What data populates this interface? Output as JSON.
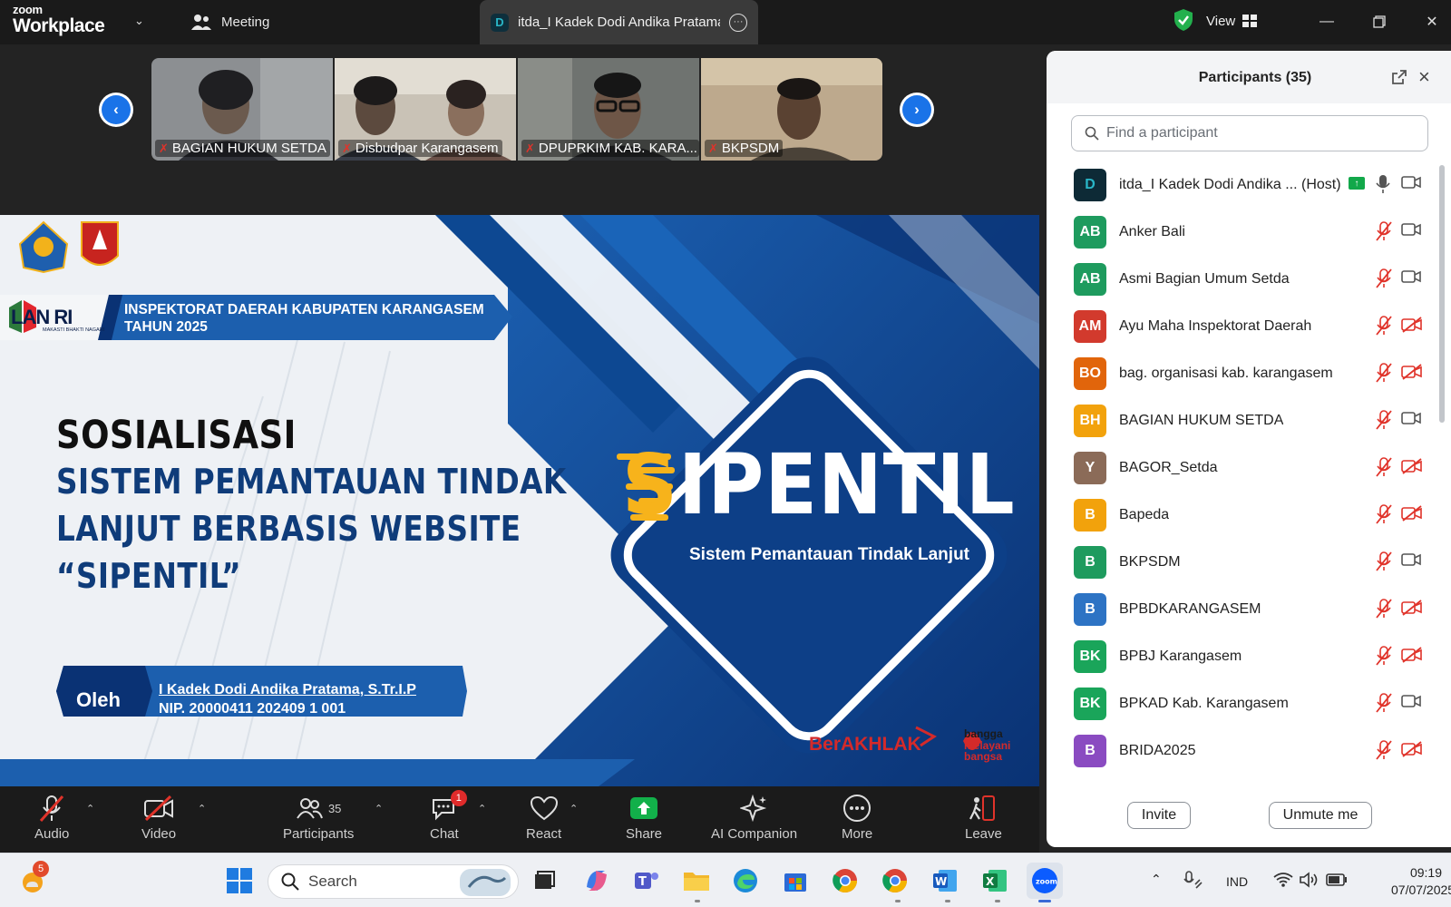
{
  "topbar": {
    "logo_line1": "zoom",
    "logo_line2": "Workplace",
    "meeting_tab": "Meeting",
    "active_tab_title": "itda_I Kadek Dodi Andika Pratama",
    "active_tab_badge": "D",
    "view_label": "View"
  },
  "thumbnails": [
    {
      "name": "BAGIAN HUKUM SETDA"
    },
    {
      "name": "Disbudpar Karangasem"
    },
    {
      "name": "DPUPRKIM KAB. KARA..."
    },
    {
      "name": "BKPSDM"
    }
  ],
  "slide": {
    "banner_line1": "INSPEKTORAT DAERAH KABUPATEN KARANGASEM",
    "banner_line2": "TAHUN 2025",
    "lanri": "LAN RI",
    "lanri_sub": "MAKASTI BHAKTI NAGARI",
    "logo_label": "KARANGASEM",
    "heading1": "SOSIALISASI",
    "heading2": "SISTEM PEMANTAUAN TINDAK",
    "heading3": "LANJUT BERBASIS WEBSITE",
    "heading4": "“SIPENTIL”",
    "oleh": "Oleh",
    "presenter_name": "I Kadek Dodi Andika Pratama, S.Tr.I.P",
    "presenter_nip": "NIP. 20000411 202409 1 001",
    "sipentil_s": "S",
    "sipentil_rest": "IPENTIL",
    "sipentil_sub": "Sistem Pemantauan Tindak Lanjut",
    "berakhlak": "BerAKHLAK",
    "bangga_1": "bangga",
    "bangga_2": "melayani",
    "bangga_3": "bangsa"
  },
  "toolbar": {
    "audio": "Audio",
    "video": "Video",
    "participants": "Participants",
    "participants_count": "35",
    "chat": "Chat",
    "chat_badge": "1",
    "react": "React",
    "share": "Share",
    "ai_companion": "AI Companion",
    "more": "More",
    "leave": "Leave"
  },
  "panel": {
    "title": "Participants (35)",
    "search_placeholder": "Find a participant",
    "invite": "Invite",
    "unmute_me": "Unmute me",
    "participants": [
      {
        "initials": "D",
        "name": "itda_I Kadek Dodi Andika ... (Host)",
        "color": "#0d2a36",
        "mic": "on",
        "cam": "on",
        "host": true
      },
      {
        "initials": "AB",
        "name": "Anker Bali",
        "color": "#1e9b5e",
        "mic": "muted",
        "cam": "on"
      },
      {
        "initials": "AB",
        "name": "Asmi Bagian Umum Setda",
        "color": "#1e9b5e",
        "mic": "muted",
        "cam": "on"
      },
      {
        "initials": "AM",
        "name": "Ayu Maha Inspektorat Daerah",
        "color": "#d23a2d",
        "mic": "muted",
        "cam": "off"
      },
      {
        "initials": "BO",
        "name": "bag. organisasi kab. karangasem",
        "color": "#e1650b",
        "mic": "muted",
        "cam": "off"
      },
      {
        "initials": "BH",
        "name": "BAGIAN HUKUM SETDA",
        "color": "#f2a20c",
        "mic": "muted",
        "cam": "on"
      },
      {
        "initials": "Y",
        "name": "BAGOR_Setda",
        "color": "#8b6b58",
        "mic": "muted",
        "cam": "off"
      },
      {
        "initials": "B",
        "name": "Bapeda",
        "color": "#f2a20c",
        "mic": "muted",
        "cam": "off"
      },
      {
        "initials": "B",
        "name": "BKPSDM",
        "color": "#1e9b5e",
        "mic": "muted",
        "cam": "on"
      },
      {
        "initials": "B",
        "name": "BPBDKARANGASEM",
        "color": "#2d73c4",
        "mic": "muted",
        "cam": "off"
      },
      {
        "initials": "BK",
        "name": "BPBJ Karangasem",
        "color": "#1aa55a",
        "mic": "muted",
        "cam": "off"
      },
      {
        "initials": "BK",
        "name": "BPKAD Kab. Karangasem",
        "color": "#1aa55a",
        "mic": "muted",
        "cam": "on"
      },
      {
        "initials": "B",
        "name": "BRIDA2025",
        "color": "#8a4bc1",
        "mic": "muted",
        "cam": "off"
      }
    ]
  },
  "taskbar": {
    "weather_badge": "5",
    "search_placeholder": "Search",
    "lang": "IND",
    "time": "09:19",
    "date": "07/07/2025"
  }
}
